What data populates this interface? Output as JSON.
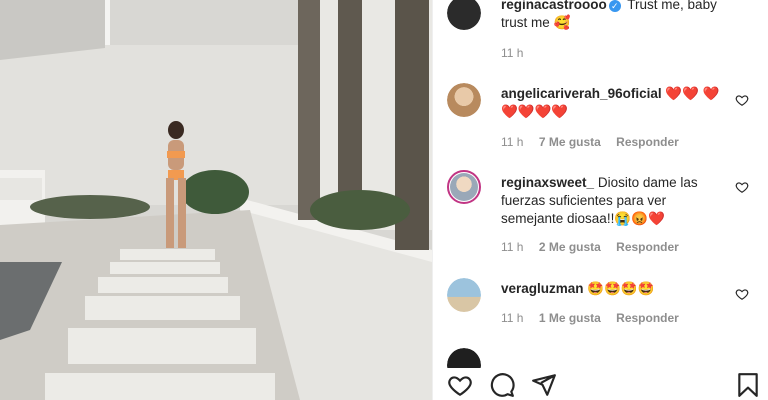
{
  "post": {
    "author": "reginacastroooo",
    "caption": "Trust me, baby trust me 🥰",
    "time": "11 h",
    "verified_mark": "✓"
  },
  "comments": [
    {
      "user": "angelicariverah_96oficial",
      "text": "❤️❤️ ❤️❤️❤️❤️❤️",
      "time": "11 h",
      "likes": "7 Me gusta",
      "reply": "Responder"
    },
    {
      "user": "reginaxsweet_",
      "text": "Diosito dame las fuerzas suficientes para ver semejante diosaa!!😭😡❤️",
      "time": "11 h",
      "likes": "2 Me gusta",
      "reply": "Responder"
    },
    {
      "user": "veragluzman",
      "text": "🤩🤩🤩🤩",
      "time": "11 h",
      "likes": "1 Me gusta",
      "reply": "Responder"
    }
  ],
  "icons": {
    "like": "heart-outline-icon",
    "comment": "speech-bubble-icon",
    "share": "paper-plane-icon",
    "save": "bookmark-icon"
  },
  "colors": {
    "text": "#262626",
    "meta": "#8e8e8e",
    "story_ring": "#c13584",
    "verified": "#3897f0"
  }
}
